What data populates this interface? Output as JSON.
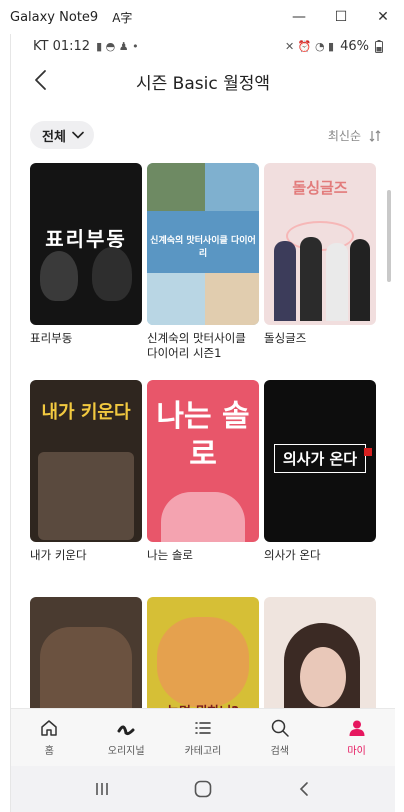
{
  "window": {
    "title": "Galaxy Note9",
    "icon_glyph": "A字",
    "controls": {
      "minimize": "—",
      "maximize": "☐",
      "close": "✕"
    }
  },
  "status": {
    "carrier_time": "KT 01:12",
    "icons_left": "▮ ◓ ♟ •",
    "icons_right": "✕ ⏰ ◔ ▮",
    "battery": "46%"
  },
  "header": {
    "title": "시즌 Basic 월정액",
    "back_icon": "chevron-left-icon"
  },
  "filter": {
    "chip_label": "전체",
    "sort_label": "최신순",
    "sort_icon": "↓↑"
  },
  "cards": [
    {
      "label": "표리부동",
      "poster_text": "표리부동",
      "bg": "#1a1a1a"
    },
    {
      "label": "신계숙의 맛터사이클 다이어리 시즌1",
      "poster_text": "신계숙의 맛터사이클 다이어리",
      "bg": "#6aa4c9"
    },
    {
      "label": "돌싱글즈",
      "poster_text": "돌싱글즈",
      "bg": "#f3d7d7"
    },
    {
      "label": "내가 키운다",
      "poster_text": "내가 키운다",
      "bg": "#3a2f25"
    },
    {
      "label": "나는 솔로",
      "poster_text": "나는 솔로",
      "bg": "#e04a5f"
    },
    {
      "label": "의사가 온다",
      "poster_text": "의사가 온다",
      "bg": "#0e0e0e"
    },
    {
      "label": "",
      "poster_text": "",
      "bg": "#4b3a2e"
    },
    {
      "label": "",
      "poster_text": "놀면 뭐하니?",
      "bg": "#d9c22f"
    },
    {
      "label": "",
      "poster_text": "",
      "bg": "#e8d9d2"
    }
  ],
  "nav": [
    {
      "label": "홈",
      "icon": "home-icon"
    },
    {
      "label": "오리지널",
      "icon": "original-icon"
    },
    {
      "label": "카테고리",
      "icon": "list-icon"
    },
    {
      "label": "검색",
      "icon": "search-icon"
    },
    {
      "label": "마이",
      "icon": "person-icon"
    }
  ],
  "colors": {
    "accent": "#e6175f"
  }
}
